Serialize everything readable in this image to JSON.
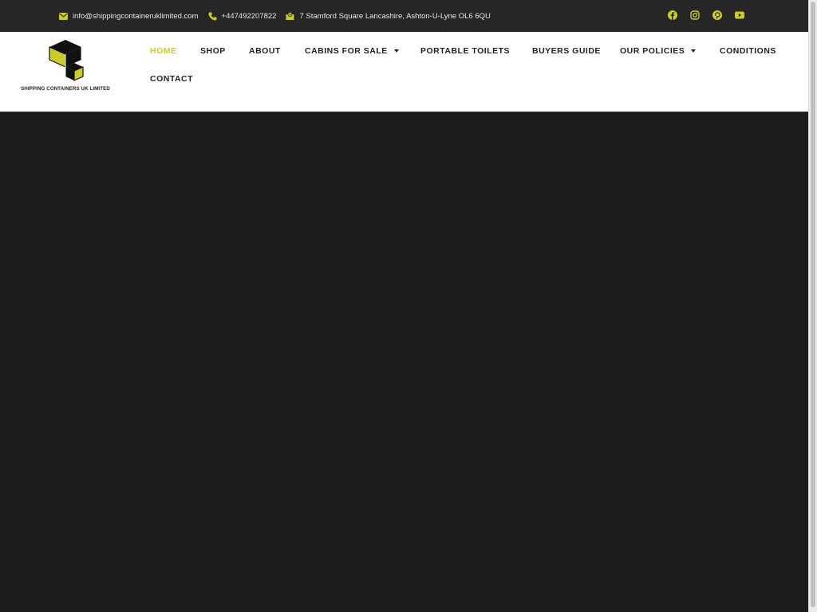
{
  "topbar": {
    "email": "info@shippingcontaineruklimited.com",
    "phone": "+447492207822",
    "address": "7 Stamford Square Lancashire, Ashton-U-Lyne OL6 6QU",
    "icons": [
      "envelope-icon",
      "phone-icon",
      "map-pin-icon"
    ],
    "social": [
      "facebook-icon",
      "instagram-icon",
      "pinterest-icon",
      "youtube-icon"
    ]
  },
  "header": {
    "logo_text": "SHIPPING CONTAINERS UK LIMITED"
  },
  "nav": {
    "items": [
      {
        "label": "HOME",
        "active": true
      },
      {
        "label": "SHOP"
      },
      {
        "label": "ABOUT"
      },
      {
        "label": "CABINS FOR SALE",
        "dropdown": true
      },
      {
        "label": "PORTABLE TOILETS"
      },
      {
        "label": "BUYERS GUIDE"
      },
      {
        "label": "OUR POLICIES",
        "dropdown": true
      },
      {
        "label": "CONDITIONS"
      },
      {
        "label": "CONTACT"
      }
    ]
  },
  "colors": {
    "accent": "#c9cc2c",
    "topbar_bg": "#262626",
    "hero_bg": "#1d1d1d",
    "nav_text": "#222222"
  }
}
